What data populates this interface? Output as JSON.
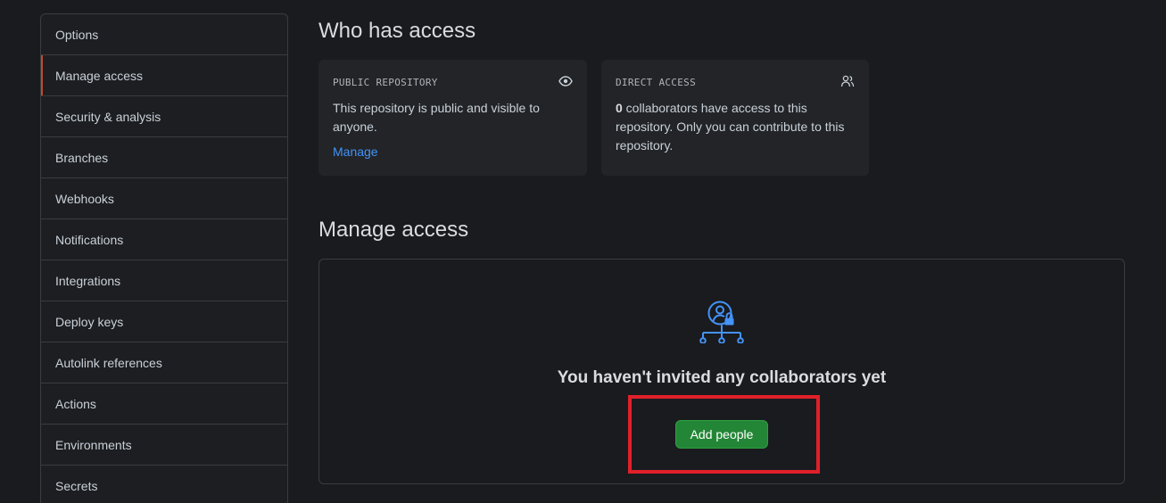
{
  "sidebar": {
    "items": [
      {
        "label": "Options"
      },
      {
        "label": "Manage access",
        "selected": true
      },
      {
        "label": "Security & analysis"
      },
      {
        "label": "Branches"
      },
      {
        "label": "Webhooks"
      },
      {
        "label": "Notifications"
      },
      {
        "label": "Integrations"
      },
      {
        "label": "Deploy keys"
      },
      {
        "label": "Autolink references"
      },
      {
        "label": "Actions"
      },
      {
        "label": "Environments"
      },
      {
        "label": "Secrets"
      }
    ]
  },
  "who_has_access": {
    "title": "Who has access",
    "public_card": {
      "label": "PUBLIC REPOSITORY",
      "text": "This repository is public and visible to anyone.",
      "link": "Manage",
      "icon": "eye-icon"
    },
    "direct_card": {
      "label": "DIRECT ACCESS",
      "count": "0",
      "text": " collaborators have access to this repository. Only you can contribute to this repository.",
      "icon": "people-icon"
    }
  },
  "manage_access": {
    "title": "Manage access",
    "empty_icon": "person-lock-network-icon",
    "empty_title": "You haven't invited any collaborators yet",
    "add_button": "Add people"
  },
  "colors": {
    "background": "#1a1b1e",
    "accent_link": "#4493f8",
    "button_green": "#238636",
    "selected_marker": "#c14a29",
    "highlight_box": "#e0202a"
  }
}
